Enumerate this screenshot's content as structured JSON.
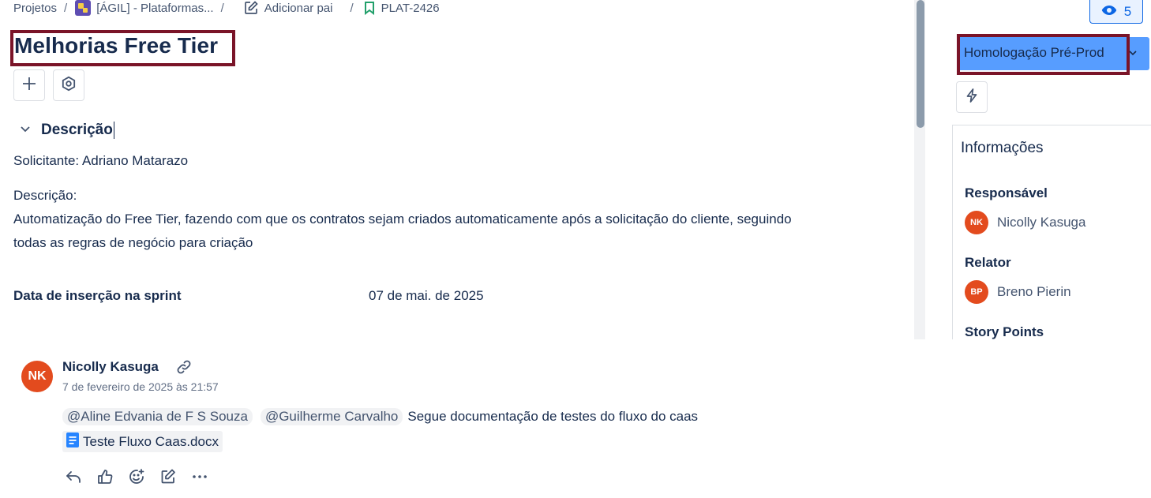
{
  "breadcrumb": {
    "projects": "Projetos",
    "project": "[ÁGIL] - Plataformas...",
    "add_parent": "Adicionar pai",
    "issue_key": "PLAT-2426"
  },
  "issue": {
    "title": "Melhorias Free Tier"
  },
  "description": {
    "heading": "Descrição",
    "requester": "Solicitante: Adriano Matarazo",
    "label": "Descrição:",
    "text_line1": "Automatização do Free Tier, fazendo com que os contratos sejam criados automaticamente após a solicitação do cliente, seguindo",
    "text_line2": "todas as regras de negócio para criação"
  },
  "fields": {
    "sprint_date_label": "Data de inserção na sprint",
    "sprint_date_value": "07 de mai. de 2025"
  },
  "sidebar": {
    "watchers": "5",
    "status": "Homologação Pré-Prod",
    "info_title": "Informações",
    "assignee_label": "Responsável",
    "assignee_name": "Nicolly Kasuga",
    "assignee_initials": "NK",
    "reporter_label": "Relator",
    "reporter_name": "Breno Pierin",
    "reporter_initials": "BP",
    "story_points_label": "Story Points"
  },
  "comment": {
    "author": "Nicolly Kasuga",
    "initials": "NK",
    "timestamp": "7 de fevereiro de 2025 às 21:57",
    "mention1": "@Aline Edvania de F S Souza",
    "mention2": "@Guilherme Carvalho",
    "text": "Segue documentação de testes do fluxo do caas",
    "attachment": "Teste Fluxo Caas.docx"
  },
  "colors": {
    "accent": "#0c66e4",
    "status_bg": "#579dff",
    "highlight_border": "#7a1428",
    "avatar": "#e34b1e"
  }
}
